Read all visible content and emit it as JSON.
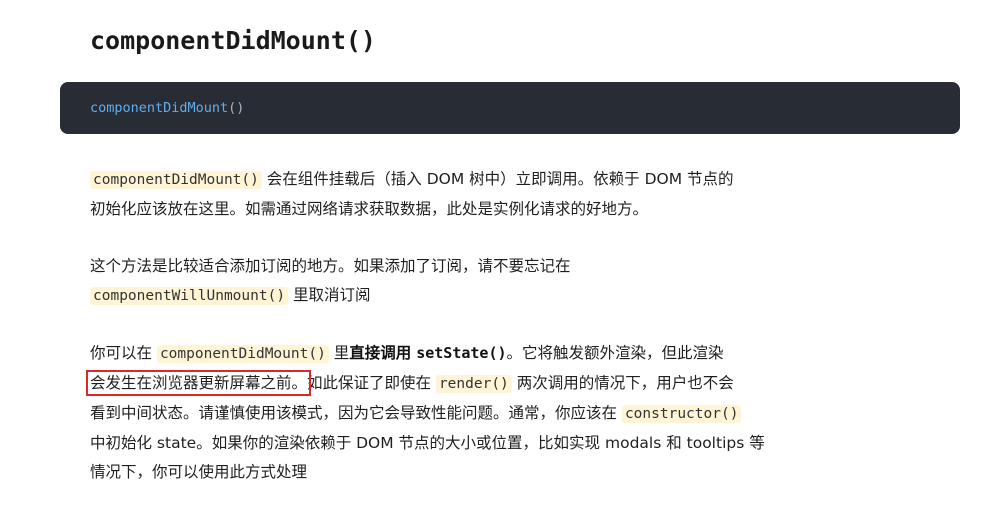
{
  "heading": "componentDidMount()",
  "code_block": {
    "fn_name": "componentDidMount",
    "parens": "()"
  },
  "para1": {
    "line1_code": "componentDidMount()",
    "line1_text": " 会在组件挂载后（插入 DOM 树中）立即调用。依赖于 DOM 节点的",
    "line2_text": "初始化应该放在这里。如需通过网络请求获取数据，此处是实例化请求的好地方。"
  },
  "para2": {
    "line1_text": "这个方法是比较适合添加订阅的地方。如果添加了订阅，请不要忘记在",
    "line2_code": "componentWillUnmount()",
    "line2_text": " 里取消订阅"
  },
  "para3": {
    "l1_a": "你可以在 ",
    "l1_code": "componentDidMount()",
    "l1_b": " 里",
    "l1_strong": "直接调用",
    "l1_space": " ",
    "l1_strong_code": "setState()",
    "l1_c": "。它将触发额外渲染，但此渲染",
    "l2_boxed": "会发生在浏览器更新屏幕之前。",
    "l2_a": "如此保证了即使在 ",
    "l2_code": "render()",
    "l2_b": " 两次调用的情况下，用户也不会",
    "l3_a": "看到中间状态。请谨慎使用该模式，因为它会导致性能问题。通常，你应该在 ",
    "l3_code": "constructor()",
    "l4_a": "中初始化 state。如果你的渲染依赖于 DOM 节点的大小或位置，比如实现 modals 和 tooltips 等",
    "l5_a": "情况下，你可以使用此方式处理"
  }
}
